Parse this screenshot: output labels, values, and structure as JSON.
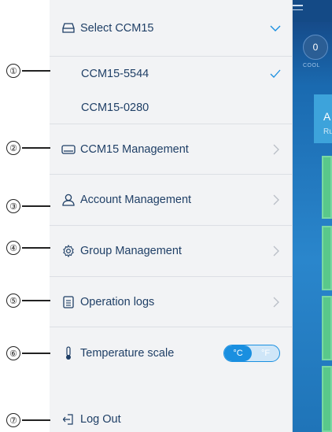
{
  "callouts": [
    "①",
    "②",
    "③",
    "④",
    "⑤",
    "⑥",
    "⑦"
  ],
  "drawer": {
    "select_header": "Select CCM15",
    "devices": [
      {
        "label": "CCM15-5544",
        "selected": true
      },
      {
        "label": "CCM15-0280",
        "selected": false
      }
    ],
    "menu": [
      {
        "label": "CCM15 Management",
        "icon": "device-icon"
      },
      {
        "label": "Account Management",
        "icon": "user-icon"
      },
      {
        "label": "Group Management",
        "icon": "gear-icon"
      },
      {
        "label": "Operation logs",
        "icon": "document-icon"
      }
    ],
    "temperature": {
      "label": "Temperature scale",
      "celsius": "°C",
      "fahrenheit": "°F",
      "selected": "°C"
    },
    "logout": "Log Out"
  },
  "background_app": {
    "counter_value": "0",
    "counter_label": "COOL",
    "card_letter": "A",
    "card_sub": "Ru"
  },
  "colors": {
    "accent": "#1a8fe0",
    "text": "#1f3f66",
    "drawer_bg": "#f2f3f5"
  }
}
